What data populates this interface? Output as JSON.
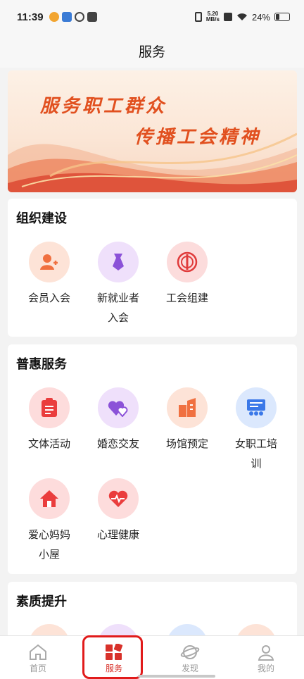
{
  "status_bar": {
    "time": "11:39",
    "net_speed_value": "5.20",
    "net_speed_unit": "MB/s",
    "battery": "24%"
  },
  "header": {
    "title": "服务"
  },
  "banner": {
    "line1": "服务职工群众",
    "line2": "传播工会精神"
  },
  "sections": [
    {
      "title": "组织建设",
      "items": [
        {
          "label": "会员入会",
          "icon": "member-join-icon",
          "bg": "#fde3d7",
          "color": "#f07040"
        },
        {
          "label": "新就业者入会",
          "icon": "tie-icon",
          "bg": "#efe0fb",
          "color": "#8b52d8"
        },
        {
          "label": "工会组建",
          "icon": "union-emblem-icon",
          "bg": "#fcdcdc",
          "color": "#e03b3b"
        }
      ]
    },
    {
      "title": "普惠服务",
      "items": [
        {
          "label": "文体活动",
          "icon": "clipboard-icon",
          "bg": "#fddcdc",
          "color": "#ea3d3d"
        },
        {
          "label": "婚恋交友",
          "icon": "hearts-icon",
          "bg": "#efe0fb",
          "color": "#8b52d8"
        },
        {
          "label": "场馆预定",
          "icon": "building-icon",
          "bg": "#fde3d7",
          "color": "#f07040"
        },
        {
          "label": "女职工培训",
          "icon": "training-board-icon",
          "bg": "#dbe8fd",
          "color": "#3a78e8"
        },
        {
          "label": "爱心妈妈小屋",
          "icon": "house-icon",
          "bg": "#fddcdc",
          "color": "#ea3d3d"
        },
        {
          "label": "心理健康",
          "icon": "heartbeat-icon",
          "bg": "#fddcdc",
          "color": "#ea3d3d"
        }
      ]
    },
    {
      "title": "素质提升",
      "items": []
    }
  ],
  "tabbar": {
    "items": [
      {
        "label": "首页",
        "icon": "home-icon"
      },
      {
        "label": "服务",
        "icon": "service-grid-icon",
        "active": true
      },
      {
        "label": "发现",
        "icon": "planet-icon"
      },
      {
        "label": "我的",
        "icon": "user-icon"
      }
    ]
  },
  "colors": {
    "accent": "#d8312a",
    "banner_text": "#e1501f",
    "highlight": "#e11b1b"
  }
}
